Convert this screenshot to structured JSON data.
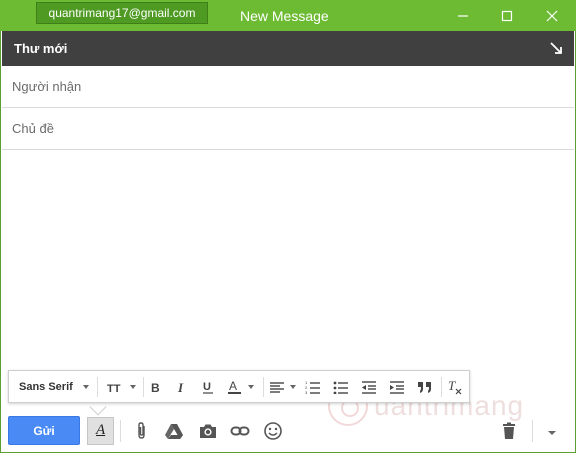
{
  "window": {
    "account": "quantrimang17@gmail.com",
    "title": "New Message",
    "controls": [
      "minimize-icon",
      "maximize-icon",
      "close-icon"
    ]
  },
  "compose": {
    "header_title": "Thư mới",
    "expand_icon": "expand-arrow-icon"
  },
  "fields": {
    "to_placeholder": "Người nhận",
    "subject_placeholder": "Chủ đề"
  },
  "format_toolbar": {
    "font_family": "Sans Serif",
    "icons": [
      "font-size-icon",
      "bold-icon",
      "italic-icon",
      "underline-icon",
      "text-color-icon",
      "align-icon",
      "numbered-list-icon",
      "bulleted-list-icon",
      "indent-less-icon",
      "indent-more-icon",
      "quote-icon",
      "remove-formatting-icon"
    ]
  },
  "actions": {
    "send_label": "Gửi",
    "icons": [
      "formatting-options-icon",
      "attach-icon",
      "drive-icon",
      "photo-icon",
      "link-icon",
      "emoji-icon",
      "trash-icon",
      "more-options-icon"
    ]
  },
  "colors": {
    "titlebar": "#6cbb33",
    "account_badge": "#4e9a22",
    "compose_header": "#404040",
    "send_button": "#4a8af4"
  },
  "watermark": "uantrimang"
}
